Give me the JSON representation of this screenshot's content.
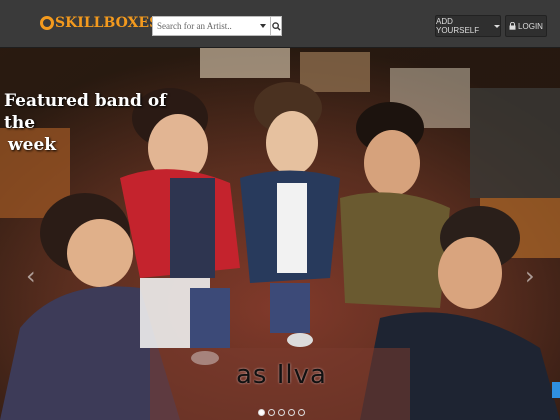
{
  "header": {
    "logo_text": "SKILLBOXES",
    "search_placeholder": "Search for an Artist..",
    "add_yourself_label": "ADD YOURSELF",
    "login_label": "LOGIN"
  },
  "hero": {
    "featured_title_line1": "Featured band of the",
    "featured_title_line2": "week",
    "band_name": "as Ilva",
    "prev_arrow": "‹",
    "next_arrow": "›",
    "slides": 5,
    "active_slide": 0
  },
  "colors": {
    "brand_orange": "#f39a1e",
    "navbar_bg": "#3a3a3a",
    "accent_blue": "#2f8fe0"
  },
  "icons": {
    "search": "search-icon",
    "lock": "lock-icon",
    "caret": "caret-down-icon"
  }
}
